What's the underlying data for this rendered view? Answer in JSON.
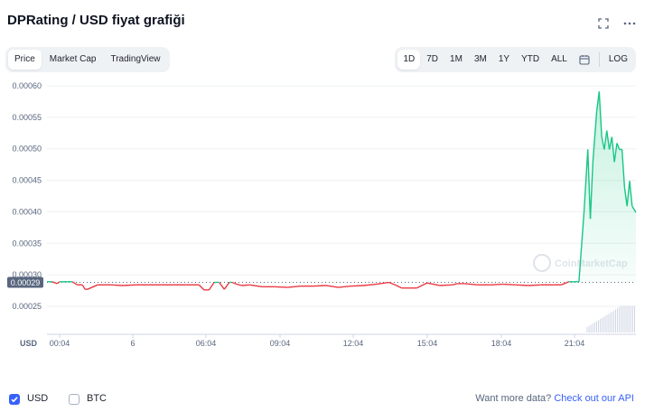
{
  "title": "DPRating / USD fiyat grafiği",
  "tabs": [
    {
      "label": "Price",
      "active": true
    },
    {
      "label": "Market Cap",
      "active": false
    },
    {
      "label": "TradingView",
      "active": false
    }
  ],
  "ranges": [
    {
      "label": "1D",
      "active": true
    },
    {
      "label": "7D",
      "active": false
    },
    {
      "label": "1M",
      "active": false
    },
    {
      "label": "3M",
      "active": false
    },
    {
      "label": "1Y",
      "active": false
    },
    {
      "label": "YTD",
      "active": false
    },
    {
      "label": "ALL",
      "active": false
    }
  ],
  "log_label": "LOG",
  "watermark": "CoinMarketCap",
  "currency_axis_label": "USD",
  "current_price_label": "0.00029",
  "colors": {
    "up": "#16c784",
    "down": "#ea3943",
    "accent": "#3861fb",
    "line": "#222531"
  },
  "footer": {
    "usd_label": "USD",
    "usd_checked": true,
    "btc_label": "BTC",
    "btc_checked": false,
    "api_text": "Want more data?",
    "api_link": "Check out our API"
  },
  "chart_data": {
    "type": "line",
    "title": "DPRating / USD fiyat grafiği",
    "ylabel": "USD",
    "y_ticks": [
      "0.00060",
      "0.00055",
      "0.00050",
      "0.00045",
      "0.00040",
      "0.00035",
      "0.00030",
      "0.00025"
    ],
    "x_ticks": [
      "00:04",
      "6",
      "06:04",
      "09:04",
      "12:04",
      "15:04",
      "18:04",
      "21:04"
    ],
    "ylim": [
      0.0002,
      0.000605
    ],
    "baseline": 0.000288,
    "current_price": 0.00029,
    "series": [
      {
        "x": [
          0,
          0.2,
          0.4,
          0.5,
          0.6,
          0.8,
          1.0,
          1.2,
          1.4,
          1.5,
          1.6,
          2.0,
          2.5,
          3.0,
          3.5,
          4.0,
          4.5,
          5.0,
          5.5,
          6.0,
          6.2,
          6.4,
          6.6,
          6.8,
          7.0,
          7.2,
          7.3,
          7.5,
          7.7,
          8.0,
          8.5,
          9.0,
          9.5,
          10.0,
          10.5,
          11.0,
          11.5,
          12.0,
          12.5,
          13.0,
          13.5,
          13.8,
          14.0,
          14.3,
          14.6,
          15.0,
          15.5,
          16.0,
          16.2,
          16.5,
          17.0,
          17.5,
          18.0,
          18.5,
          19.0,
          19.5,
          20.0,
          20.3,
          20.6,
          20.8,
          21.0,
          21.2,
          21.35,
          21.45,
          21.55,
          21.7,
          21.8,
          21.9,
          22.0,
          22.1,
          22.2,
          22.3,
          22.4,
          22.5,
          22.6,
          22.7,
          22.8,
          22.9,
          23.0,
          23.1,
          23.25
        ],
        "y": [
          0.000289,
          0.000289,
          0.000286,
          0.000289,
          0.000289,
          0.000289,
          0.000289,
          0.000284,
          0.000284,
          0.000277,
          0.000277,
          0.000284,
          0.000284,
          0.000283,
          0.000284,
          0.000284,
          0.000284,
          0.000284,
          0.000284,
          0.000284,
          0.000276,
          0.000276,
          0.000288,
          0.000288,
          0.000277,
          0.000288,
          0.000288,
          0.000285,
          0.000283,
          0.000284,
          0.000281,
          0.000281,
          0.00028,
          0.000282,
          0.000282,
          0.000283,
          0.00028,
          0.000282,
          0.000283,
          0.000285,
          0.000288,
          0.000283,
          0.000279,
          0.000279,
          0.000279,
          0.000287,
          0.000283,
          0.000284,
          0.000286,
          0.000286,
          0.000284,
          0.000284,
          0.000285,
          0.000284,
          0.000283,
          0.000284,
          0.000284,
          0.000284,
          0.000289,
          0.000289,
          0.000289,
          0.000399,
          0.000499,
          0.000389,
          0.000479,
          0.000559,
          0.000591,
          0.000519,
          0.000499,
          0.000529,
          0.000499,
          0.000519,
          0.000479,
          0.000509,
          0.000499,
          0.000499,
          0.000439,
          0.000409,
          0.000449,
          0.000409,
          0.000399
        ]
      }
    ]
  }
}
